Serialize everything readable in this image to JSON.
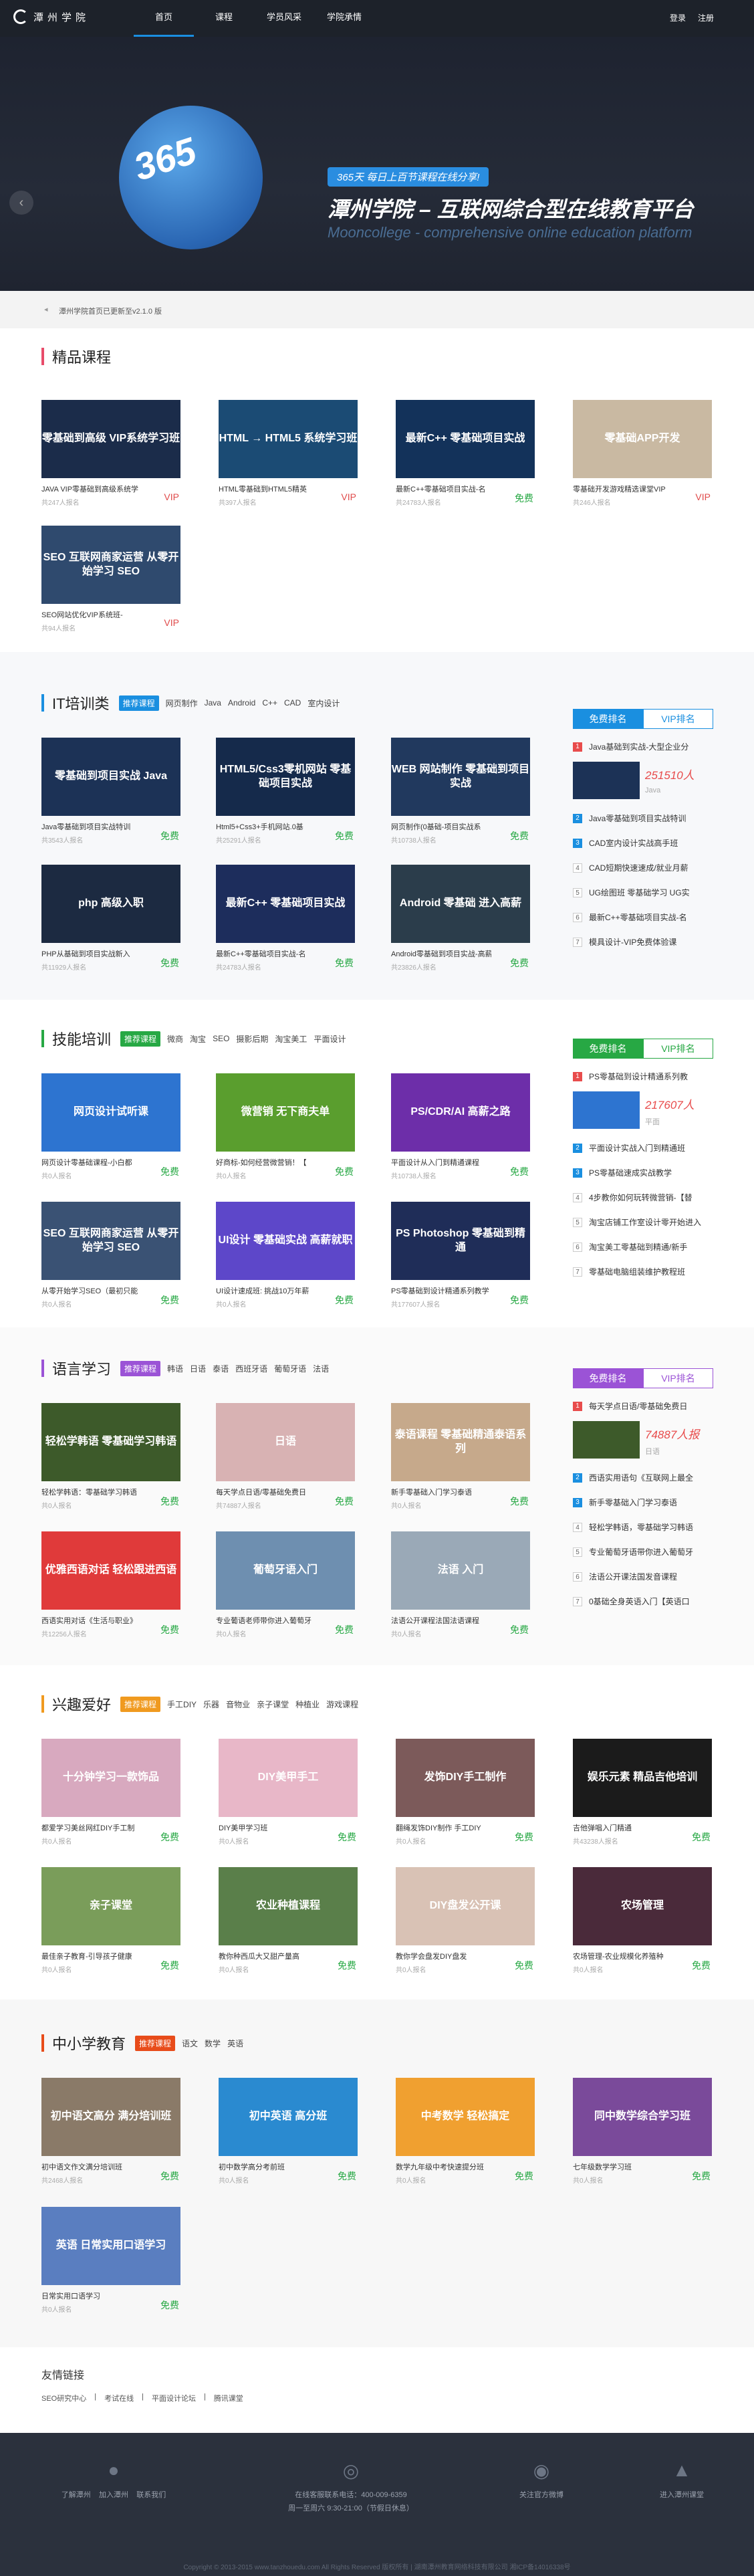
{
  "nav": {
    "logo": "潭州学院",
    "links": [
      "首页",
      "课程",
      "学员风采",
      "学院承情"
    ],
    "login": "登录",
    "register": "注册"
  },
  "banner": {
    "globe": "365",
    "ribbon": "365天 每日上百节课程在线分享!",
    "title": "潭州学院 – 互联网综合型在线教育平台",
    "sub": "Mooncollege - comprehensive online education platform",
    "prev": "‹"
  },
  "notice": "潭州学院首页已更新至v2.1.0 版",
  "sections": {
    "jingpin": {
      "title": "精品课程",
      "color": "#e84c6a",
      "cards": [
        {
          "thumb": "零基础到高级 VIP系统学习班",
          "title": "JAVA VIP零基础到高级系统学",
          "num": "共247人报名",
          "price": "VIP",
          "bg": "#1b2c4a"
        },
        {
          "thumb": "HTML → HTML5 系统学习班",
          "title": "HTML零基础到HTML5精英",
          "num": "共397人报名",
          "price": "VIP",
          "bg": "#1b4b74"
        },
        {
          "thumb": "最新C++ 零基础项目实战",
          "title": "最新C++零基础项目实战-名",
          "num": "共24783人报名",
          "price": "免费",
          "bg": "#13325a"
        },
        {
          "thumb": "零基础APP开发",
          "title": "零基础开发游戏精选课堂VIP",
          "num": "共246人报名",
          "price": "VIP",
          "bg": "#c9b9a2"
        },
        {
          "thumb": "SEO 互联网商家运营 从零开始学习 SEO",
          "title": "SEO网站优化VIP系统班-",
          "num": "共94人报名",
          "price": "VIP",
          "bg": "#2f4a6e"
        }
      ]
    },
    "it": {
      "title": "IT培训类",
      "color": "#1a8fe0",
      "hot": "推荐课程",
      "tags": [
        "网页制作",
        "Java",
        "Android",
        "C++",
        "CAD",
        "室内设计"
      ],
      "cards": [
        {
          "thumb": "零基础到项目实战 Java",
          "title": "Java零基础到项目实战特训",
          "num": "共3543人报名",
          "price": "免费",
          "bg": "#1c3256"
        },
        {
          "thumb": "HTML5/Css3零机网站 零基础项目实战",
          "title": "Html5+Css3+手机网站.0基",
          "num": "共25291人报名",
          "price": "免费",
          "bg": "#152a4b"
        },
        {
          "thumb": "WEB 网站制作 零基础到项目实战",
          "title": "网页制作(0基础-项目实战系",
          "num": "共10738人报名",
          "price": "免费",
          "bg": "#21395e"
        },
        {
          "thumb": "php 高级入职",
          "title": "PHP从基础到项目实战新入",
          "num": "共11929人报名",
          "price": "免费",
          "bg": "#1c2a41"
        },
        {
          "thumb": "最新C++ 零基础项目实战",
          "title": "最新C++零基础项目实战-名",
          "num": "共24783人报名",
          "price": "免费",
          "bg": "#1d2d5c"
        },
        {
          "thumb": "Android 零基础 进入高薪",
          "title": "Android零基础到项目实战-高薪",
          "num": "共23826人报名",
          "price": "免费",
          "bg": "#2b3d4b"
        }
      ],
      "rank": {
        "t1": "免费排名",
        "t2": "VIP排名",
        "top": {
          "name": "Java基础到实战-大型企业分",
          "count": "251510人",
          "cat": "Java"
        },
        "items": [
          "Java零基础到项目实战特训",
          "CAD室内设计实战高手班",
          "CAD短期快速速成/就业月薪",
          "UG绘图班 零基础学习 UG实",
          "最新C++零基础项目实战-名",
          "模具设计-VIP免费体验课"
        ]
      }
    },
    "skill": {
      "title": "技能培训",
      "color": "#27a844",
      "hot": "推荐课程",
      "tags": [
        "微商",
        "淘宝",
        "SEO",
        "摄影后期",
        "淘宝美工",
        "平面设计"
      ],
      "cards": [
        {
          "thumb": "网页设计试听课",
          "title": "网页设计零基础课程-小白都",
          "num": "共0人报名",
          "price": "免费",
          "bg": "#2d74d0"
        },
        {
          "thumb": "微营销 无下商夫单",
          "title": "好商标-如何经营微营销！【",
          "num": "共0人报名",
          "price": "免费",
          "bg": "#5a9e2e"
        },
        {
          "thumb": "PS/CDR/AI 高薪之路",
          "title": "平面设计从入门到精通课程",
          "num": "共10738人报名",
          "price": "免费",
          "bg": "#6d2ea9"
        },
        {
          "thumb": "SEO 互联网商家运营 从零开始学习 SEO",
          "title": "从零开始学习SEO（最初只能",
          "num": "共0人报名",
          "price": "免费",
          "bg": "#3a5274"
        },
        {
          "thumb": "UI设计 零基础实战 高薪就职",
          "title": "UI设计速成班: 挑战10万年薪",
          "num": "共0人报名",
          "price": "免费",
          "bg": "#5d47c9"
        },
        {
          "thumb": "PS Photoshop 零基础到精通",
          "title": "PS零基础到设计精通系列教学",
          "num": "共177607人报名",
          "price": "免费",
          "bg": "#1f2d58"
        }
      ],
      "rank": {
        "t1": "免费排名",
        "t2": "VIP排名",
        "top": {
          "name": "PS零基础到设计精通系列教",
          "count": "217607人",
          "cat": "平面"
        },
        "items": [
          "平面设计实战入门到精通班",
          "PS零基础速成实战教学",
          "4步教你如何玩转微营销-【替",
          "淘宝店铺工作室设计零开始进入",
          "淘宝美工零基础到精通/新手",
          "零基础电脑组装维护教程班"
        ]
      }
    },
    "lang": {
      "title": "语言学习",
      "color": "#9b53d6",
      "hot": "推荐课程",
      "tags": [
        "韩语",
        "日语",
        "泰语",
        "西班牙语",
        "葡萄牙语",
        "法语"
      ],
      "cards": [
        {
          "thumb": "轻松学韩语 零基础学习韩语",
          "title": "轻松学韩语：零基础学习韩语",
          "num": "共0人报名",
          "price": "免费",
          "bg": "#3d5a2a"
        },
        {
          "thumb": "日语",
          "title": "每天学点日语/零基础免费日",
          "num": "共74887人报名",
          "price": "免费",
          "bg": "#d8b2b3"
        },
        {
          "thumb": "泰语课程 零基础精通泰语系列",
          "title": "新手零基础入门学习泰语",
          "num": "共0人报名",
          "price": "免费",
          "bg": "#c6a98b"
        },
        {
          "thumb": "优雅西语对话 轻松跟进西语",
          "title": "西语实用对话《生活与职业》",
          "num": "共12256人报名",
          "price": "免费",
          "bg": "#e03a3a"
        },
        {
          "thumb": "葡萄牙语入门",
          "title": "专业葡语老师带你进入葡萄牙",
          "num": "共0人报名",
          "price": "免费",
          "bg": "#6e8fb0"
        },
        {
          "thumb": "法语 入门",
          "title": "法语公开课程法国法语课程",
          "num": "共0人报名",
          "price": "免费",
          "bg": "#9aa9b7"
        }
      ],
      "rank": {
        "t1": "免费排名",
        "t2": "VIP排名",
        "top": {
          "name": "每天学点日语/零基础免费日",
          "count": "74887人报",
          "cat": "日语"
        },
        "items": [
          "西语实用语句《互联网上最全",
          "新手零基础入门学习泰语",
          "轻松学韩语，零基础学习韩语",
          "专业葡萄牙语带你进入葡萄牙",
          "法语公开课法国发音课程",
          "0基础全身英语入门【英语口"
        ]
      }
    },
    "hobby": {
      "title": "兴趣爱好",
      "color": "#f09a1f",
      "hot": "推荐课程",
      "tags": [
        "手工DIY",
        "乐器",
        "音物业",
        "亲子课堂",
        "种植业",
        "游戏课程"
      ],
      "cards": [
        {
          "thumb": "十分钟学习一款饰品",
          "title": "都爱学习美丝网红DIY手工制",
          "num": "共0人报名",
          "price": "免费",
          "bg": "#d8a9bf"
        },
        {
          "thumb": "DIY美甲手工",
          "title": "DIY美甲学习班",
          "num": "共0人报名",
          "price": "免费",
          "bg": "#e8b7c8"
        },
        {
          "thumb": "发饰DIY手工制作",
          "title": "翻绳发饰DIY制作 手工DIY",
          "num": "共0人报名",
          "price": "免费",
          "bg": "#7c5a5a"
        },
        {
          "thumb": "娱乐元素 精品吉他培训",
          "title": "吉他弹唱入门精通",
          "num": "共43238人报名",
          "price": "免费",
          "bg": "#1b1b1b"
        },
        {
          "thumb": "亲子课堂",
          "title": "最佳亲子教育-引导孩子健康",
          "num": "共0人报名",
          "price": "免费",
          "bg": "#7a9d5a"
        },
        {
          "thumb": "农业种植课程",
          "title": "教你种西瓜大又甜产量高",
          "num": "共0人报名",
          "price": "免费",
          "bg": "#5a7f4a"
        },
        {
          "thumb": "DIY盘发公开课",
          "title": "教你学会盘发DIY盘发",
          "num": "共0人报名",
          "price": "免费",
          "bg": "#d9c2b5"
        },
        {
          "thumb": "农场管理",
          "title": "农场管理-农业规模化养殖种",
          "num": "共0人报名",
          "price": "免费",
          "bg": "#4a2a3a"
        }
      ]
    },
    "school": {
      "title": "中小学教育",
      "color": "#e84c1a",
      "hot": "推荐课程",
      "tags": [
        "语文",
        "数学",
        "英语"
      ],
      "cards": [
        {
          "thumb": "初中语文高分 满分培训班",
          "title": "初中语文作文满分培训班",
          "num": "共2468人报名",
          "price": "免费",
          "bg": "#8a7a68"
        },
        {
          "thumb": "初中英语 高分班",
          "title": "初中数学高分考前班",
          "num": "共0人报名",
          "price": "免费",
          "bg": "#2a8ad0"
        },
        {
          "thumb": "中考数学 轻松搞定",
          "title": "数学九年级中考快速提分班",
          "num": "共0人报名",
          "price": "免费",
          "bg": "#f0a030"
        },
        {
          "thumb": "同中数学综合学习班",
          "title": "七年级数学学习班",
          "num": "共0人报名",
          "price": "免费",
          "bg": "#7a4a9a"
        },
        {
          "thumb": "英语 日常实用口语学习",
          "title": "日常实用口语学习",
          "num": "共0人报名",
          "price": "免费",
          "bg": "#5a7ec0"
        }
      ]
    }
  },
  "friend": {
    "title": "友情链接",
    "links": [
      "SEO研究中心",
      "考试在线",
      "平面设计论坛",
      "腾讯课堂"
    ]
  },
  "footer": {
    "c1": "了解潭州",
    "c1b": "加入潭州",
    "c1c": "联系我们",
    "tel": "在线客服联系电话：400-009-6359",
    "time": "周一至周六 9:30-21:00（节假日休息）",
    "c3": "关注官方微博",
    "c4": "进入潭州课堂",
    "copy": "Copyright © 2013-2015 www.tanzhouedu.com All Rights Reserved 版权所有 | 湖南潭州教育网络科技有限公司 湘ICP备14016338号"
  }
}
